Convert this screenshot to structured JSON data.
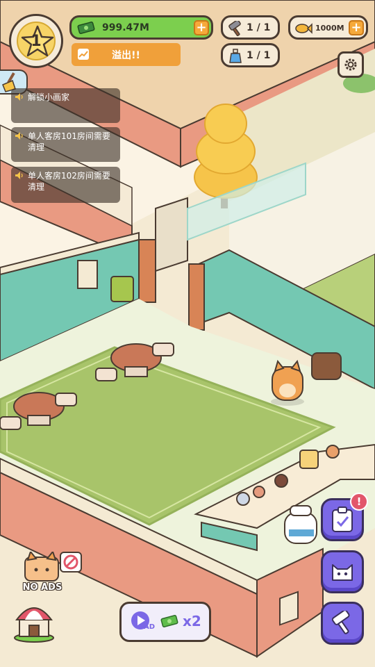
{
  "hud": {
    "level": "1",
    "cash": "999.47M",
    "overflow_label": "溢出!!",
    "hammer_count": "1 / 1",
    "fish_count": "1000M",
    "potion_count": "1 / 1"
  },
  "notifications": [
    "解锁小画家",
    "单人客房101房间需要清理",
    "单人客房102房间需要清理"
  ],
  "bottom": {
    "no_ads": "NO ADS",
    "ad_label": "AD",
    "ad_multiplier": "x2"
  },
  "badges": {
    "quest_alert": "!"
  },
  "colors": {
    "cash_green": "#7ccf4e",
    "overflow_orange": "#f0a03a",
    "wall_teal": "#74c8b2",
    "wall_salmon": "#e99a82",
    "carpet": "#a8c46a",
    "side_button": "#7b68e6"
  }
}
